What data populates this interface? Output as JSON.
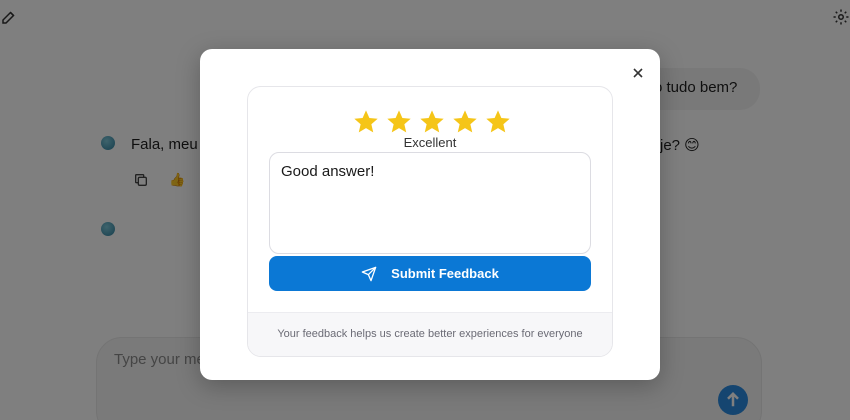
{
  "background": {
    "user_message": "o tudo bem?",
    "bot_message_left": "Fala, meu",
    "bot_message_right": "je? 😊",
    "reaction_emoji": "👍",
    "composer_placeholder": "Type your me",
    "icons": [
      "new-chat-icon",
      "settings-icon",
      "copy-icon",
      "thumbs-up-icon",
      "send-arrow-icon"
    ]
  },
  "modal": {
    "close_icon": "close-icon",
    "rating": {
      "stars_filled": 5,
      "stars_total": 5,
      "label": "Excellent",
      "star_color": "#f5c518"
    },
    "feedback": {
      "value": "Good answer!"
    },
    "submit": {
      "label": "Submit Feedback",
      "icon": "paper-plane-icon",
      "color": "#0b78d5"
    },
    "footer_text": "Your feedback helps us create better experiences for everyone"
  }
}
